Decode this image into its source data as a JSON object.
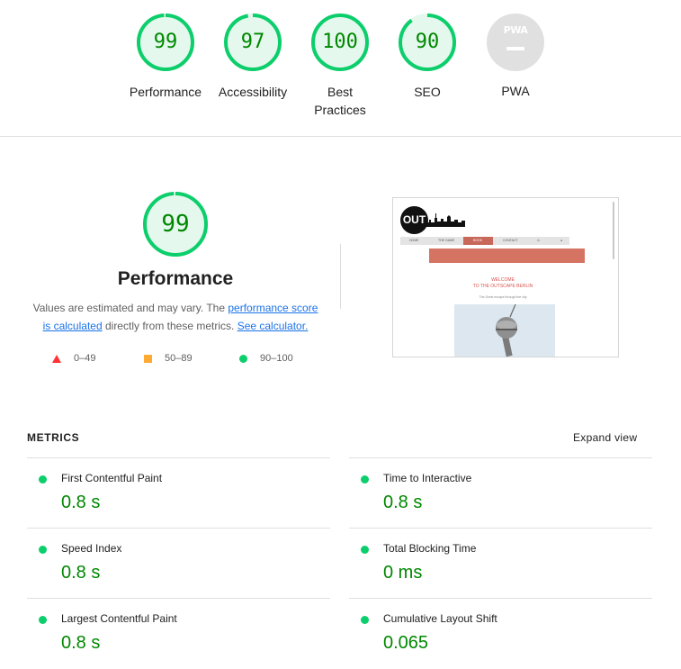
{
  "categories": [
    {
      "score": "99",
      "label": "Performance",
      "percent": 99
    },
    {
      "score": "97",
      "label": "Accessibility",
      "percent": 97
    },
    {
      "score": "100",
      "label": "Best Practices",
      "percent": 100
    },
    {
      "score": "90",
      "label": "SEO",
      "percent": 90
    }
  ],
  "pwa": {
    "badge_text": "PWA",
    "label": "PWA"
  },
  "performance": {
    "score": "99",
    "percent": 99,
    "title": "Performance",
    "desc_prefix": "Values are estimated and may vary. The ",
    "desc_link": "performance score is calculated",
    "desc_middle": " directly from these metrics. ",
    "desc_link2": "See calculator."
  },
  "legend": {
    "fail": "0–49",
    "average": "50–89",
    "pass": "90–100"
  },
  "screenshot": {
    "logo": "OUT",
    "nav": [
      "HOME",
      "THE GAME",
      "BOOK",
      "CONTACT"
    ],
    "welcome_line1": "WELCOME",
    "welcome_line2": "TO THE OUTSCAPE BERLIN",
    "subtitle": "The Great escape through the city"
  },
  "metrics": {
    "title": "METRICS",
    "expand": "Expand view",
    "items": [
      {
        "label": "First Contentful Paint",
        "value": "0.8 s"
      },
      {
        "label": "Time to Interactive",
        "value": "0.8 s"
      },
      {
        "label": "Speed Index",
        "value": "0.8 s"
      },
      {
        "label": "Total Blocking Time",
        "value": "0 ms"
      },
      {
        "label": "Largest Contentful Paint",
        "value": "0.8 s"
      },
      {
        "label": "Cumulative Layout Shift",
        "value": "0.065"
      }
    ]
  },
  "colors": {
    "pass": "#0cce6b",
    "pass_text": "#008800",
    "pass_bg": "#e5f8ee",
    "average": "#ffaa33",
    "fail": "#ff3333",
    "link": "#1a73e8"
  }
}
